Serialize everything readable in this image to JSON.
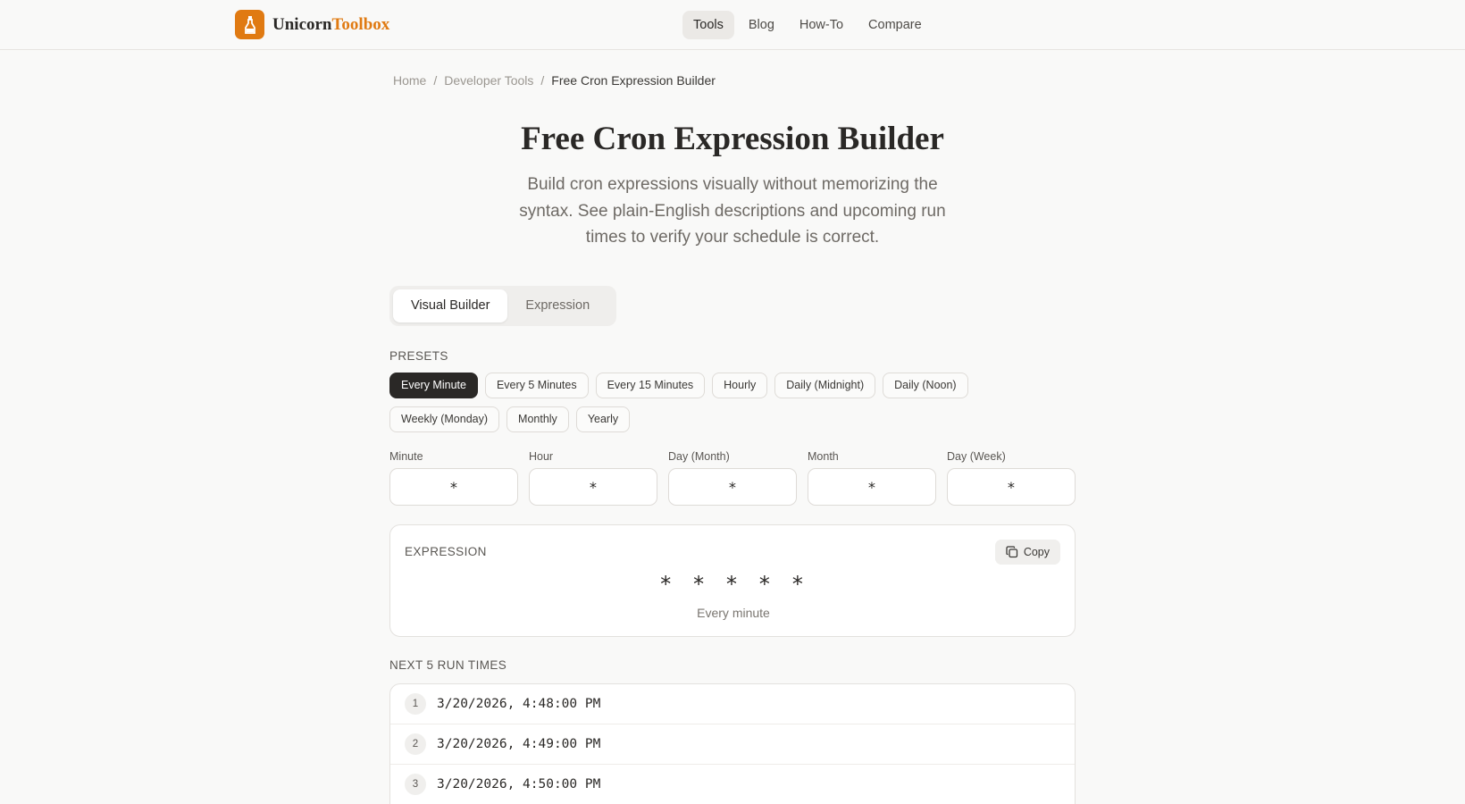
{
  "brand": {
    "name_primary": "Unicorn",
    "name_accent": "Toolbox",
    "accent_color": "#e07a12"
  },
  "nav": {
    "items": [
      {
        "label": "Tools",
        "active": true
      },
      {
        "label": "Blog"
      },
      {
        "label": "How-To"
      },
      {
        "label": "Compare"
      }
    ]
  },
  "breadcrumb": {
    "items": [
      "Home",
      "Developer Tools"
    ],
    "current": "Free Cron Expression Builder"
  },
  "page": {
    "title": "Free Cron Expression Builder",
    "subtitle": "Build cron expressions visually without memorizing the syntax. See plain-English descriptions and upcoming run times to verify your schedule is correct."
  },
  "tabs": [
    {
      "label": "Visual Builder",
      "active": true
    },
    {
      "label": "Expression"
    }
  ],
  "presets": {
    "label": "PRESETS",
    "items": [
      "Every Minute",
      "Every 5 Minutes",
      "Every 15 Minutes",
      "Hourly",
      "Daily (Midnight)",
      "Daily (Noon)",
      "Weekly (Monday)",
      "Monthly",
      "Yearly"
    ],
    "selected": "Every Minute"
  },
  "fields": [
    {
      "label": "Minute",
      "value": "*"
    },
    {
      "label": "Hour",
      "value": "*"
    },
    {
      "label": "Day (Month)",
      "value": "*"
    },
    {
      "label": "Month",
      "value": "*"
    },
    {
      "label": "Day (Week)",
      "value": "*"
    }
  ],
  "expression": {
    "label": "EXPRESSION",
    "value": "* * * * *",
    "description": "Every minute",
    "copy_label": "Copy"
  },
  "runs": {
    "label": "NEXT 5 RUN TIMES",
    "items": [
      {
        "n": "1",
        "time": "3/20/2026, 4:48:00 PM"
      },
      {
        "n": "2",
        "time": "3/20/2026, 4:49:00 PM"
      },
      {
        "n": "3",
        "time": "3/20/2026, 4:50:00 PM"
      }
    ]
  }
}
